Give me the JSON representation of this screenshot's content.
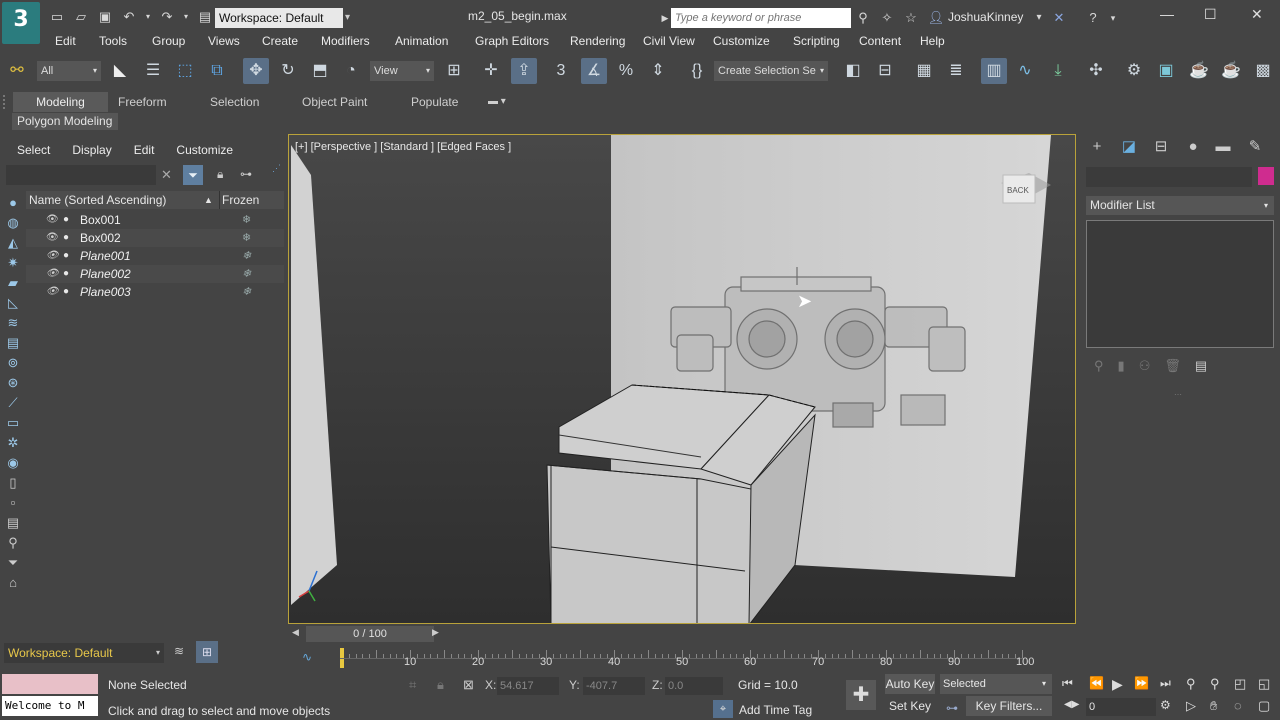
{
  "title_bar": {
    "workspace": "Workspace: Default",
    "document": "m2_05_begin.max",
    "search_placeholder": "Type a keyword or phrase",
    "user": "JoshuaKinney"
  },
  "menu": [
    "Edit",
    "Tools",
    "Group",
    "Views",
    "Create",
    "Modifiers",
    "Animation",
    "Graph Editors",
    "Rendering",
    "Civil View",
    "Customize",
    "Scripting",
    "Content",
    "Help"
  ],
  "toolbar": {
    "filter": "All",
    "ref_coord": "View",
    "selection_set": "Create Selection Se"
  },
  "ribbon": {
    "tabs": [
      "Modeling",
      "Freeform",
      "Selection",
      "Object Paint",
      "Populate"
    ],
    "panel": "Polygon Modeling"
  },
  "scene_explorer": {
    "menu": [
      "Select",
      "Display",
      "Edit",
      "Customize"
    ],
    "col_name": "Name (Sorted Ascending)",
    "col_frozen": "Frozen",
    "objects": [
      "Box001",
      "Box002",
      "Plane001",
      "Plane002",
      "Plane003"
    ],
    "workspace": "Workspace: Default"
  },
  "viewport": {
    "label": "[+] [Perspective ] [Standard ] [Edged Faces ]",
    "viewcube": "BACK"
  },
  "command_panel": {
    "modifier_list": "Modifier List",
    "object_color": "#cf2c8f"
  },
  "timeline": {
    "frame": "0 / 100",
    "ticks": [
      "10",
      "20",
      "30",
      "40",
      "50",
      "60",
      "70",
      "80",
      "90",
      "100"
    ]
  },
  "status": {
    "maxscript": "Welcome to M",
    "selection": "None Selected",
    "prompt": "Click and drag to select and move objects",
    "x_label": "X:",
    "x": "54.617",
    "y_label": "Y:",
    "y": "-407.7",
    "z_label": "Z:",
    "z": "0.0",
    "grid": "Grid = 10.0",
    "add_time_tag": "Add Time Tag",
    "auto_key": "Auto Key",
    "set_key": "Set Key",
    "key_mode": "Selected",
    "key_filters": "Key Filters...",
    "current_frame": "0"
  }
}
